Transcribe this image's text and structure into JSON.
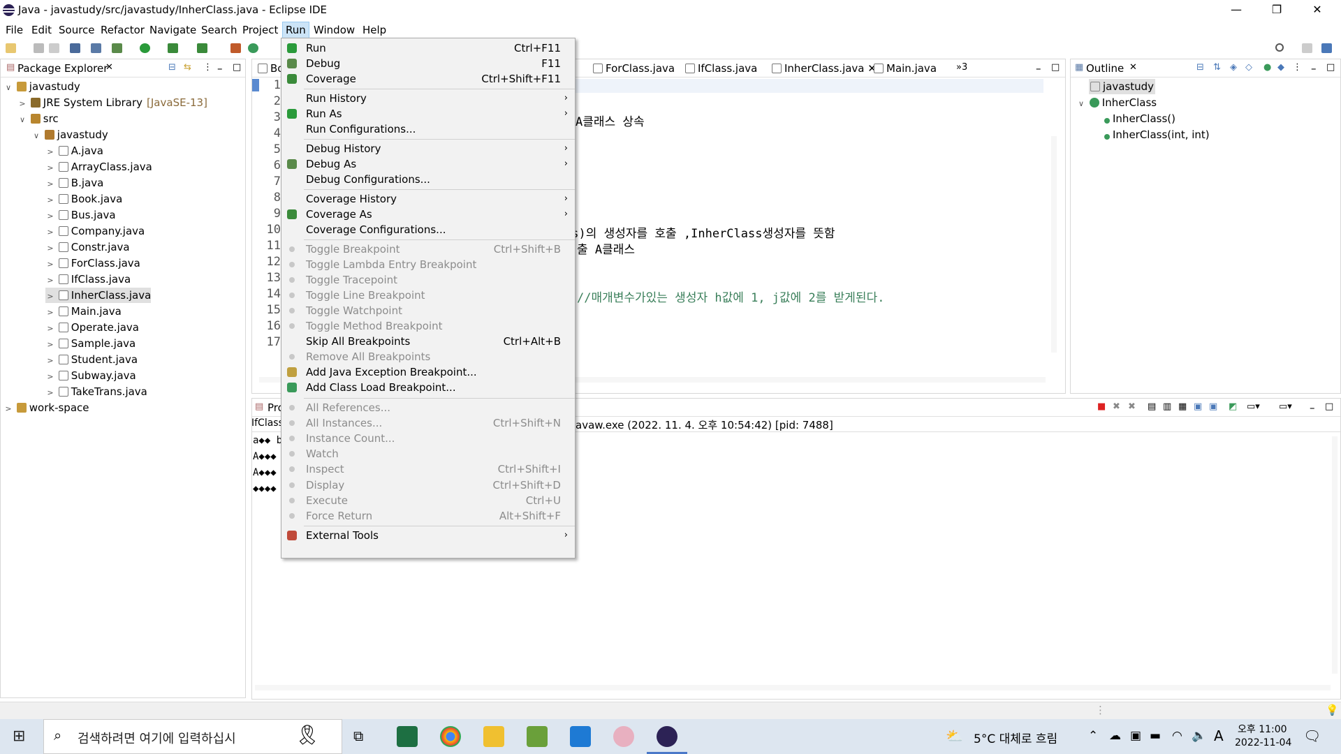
{
  "window": {
    "title": "Java - javastudy/src/javastudy/InherClass.java - Eclipse IDE",
    "min": "—",
    "max": "❐",
    "close": "✕"
  },
  "menubar": [
    "File",
    "Edit",
    "Source",
    "Refactor",
    "Navigate",
    "Search",
    "Project",
    "Run",
    "Window",
    "Help"
  ],
  "package_explorer": {
    "title": "Package Explorer",
    "tree": [
      {
        "label": "javastudy",
        "level": 0,
        "arrow": "∨",
        "icon": "project"
      },
      {
        "label": "JRE System Library",
        "extra": "[JavaSE-13]",
        "level": 1,
        "arrow": ">",
        "icon": "library"
      },
      {
        "label": "src",
        "level": 1,
        "arrow": "∨",
        "icon": "src"
      },
      {
        "label": "javastudy",
        "level": 2,
        "arrow": "∨",
        "icon": "package"
      },
      {
        "label": "A.java",
        "level": 3,
        "arrow": ">",
        "icon": "java"
      },
      {
        "label": "ArrayClass.java",
        "level": 3,
        "arrow": ">",
        "icon": "java"
      },
      {
        "label": "B.java",
        "level": 3,
        "arrow": ">",
        "icon": "java"
      },
      {
        "label": "Book.java",
        "level": 3,
        "arrow": ">",
        "icon": "java"
      },
      {
        "label": "Bus.java",
        "level": 3,
        "arrow": ">",
        "icon": "java"
      },
      {
        "label": "Company.java",
        "level": 3,
        "arrow": ">",
        "icon": "java"
      },
      {
        "label": "Constr.java",
        "level": 3,
        "arrow": ">",
        "icon": "java"
      },
      {
        "label": "ForClass.java",
        "level": 3,
        "arrow": ">",
        "icon": "java"
      },
      {
        "label": "IfClass.java",
        "level": 3,
        "arrow": ">",
        "icon": "java"
      },
      {
        "label": "InherClass.java",
        "level": 3,
        "arrow": ">",
        "icon": "java",
        "selected": true
      },
      {
        "label": "Main.java",
        "level": 3,
        "arrow": ">",
        "icon": "java"
      },
      {
        "label": "Operate.java",
        "level": 3,
        "arrow": ">",
        "icon": "java"
      },
      {
        "label": "Sample.java",
        "level": 3,
        "arrow": ">",
        "icon": "java"
      },
      {
        "label": "Student.java",
        "level": 3,
        "arrow": ">",
        "icon": "java"
      },
      {
        "label": "Subway.java",
        "level": 3,
        "arrow": ">",
        "icon": "java"
      },
      {
        "label": "TakeTrans.java",
        "level": 3,
        "arrow": ">",
        "icon": "java"
      },
      {
        "label": "work-space",
        "level": 0,
        "arrow": ">",
        "icon": "project"
      }
    ]
  },
  "editor": {
    "tabs": [
      "Bo",
      "ForClass.java",
      "IfClass.java",
      "InherClass.java",
      "Main.java"
    ],
    "overflow": "»3",
    "line_numbers": [
      "1",
      "2",
      "3",
      "4",
      "5",
      "6",
      "7",
      "8",
      "9",
      "10",
      "11",
      "12",
      "13",
      "14",
      "15",
      "16",
      "17"
    ],
    "visible_code": {
      "l3": "A클래스 상속",
      "l10": "ss)의 생성자를 호출 ,InherClass생성자를 뜻함",
      "l11": "출 A클래스",
      "l14": "//매개변수가있는 생성자 h값에 1, j값에 2를 받게된다."
    }
  },
  "outline": {
    "title": "Outline",
    "items": [
      {
        "label": "javastudy"
      },
      {
        "label": "InherClass"
      },
      {
        "label": "InherClass()"
      },
      {
        "label": "InherClass(int, int)"
      }
    ]
  },
  "console": {
    "tab": "Pro",
    "header_left": "IfClass",
    "header": "avaw.exe  (2022. 11. 4. 오후 10:54:42) [pid: 7488]",
    "lines": [
      "a◆◆ b",
      "A◆◆◆",
      "A◆◆◆",
      "◆◆◆◆"
    ]
  },
  "run_menu": {
    "items": [
      {
        "label": "Run",
        "accel": "Ctrl+F11",
        "icon": "run"
      },
      {
        "label": "Debug",
        "accel": "F11",
        "icon": "debug"
      },
      {
        "label": "Coverage",
        "accel": "Ctrl+Shift+F11",
        "icon": "coverage"
      },
      {
        "sep": true
      },
      {
        "label": "Run History",
        "submenu": true
      },
      {
        "label": "Run As",
        "submenu": true,
        "icon": "run"
      },
      {
        "label": "Run Configurations..."
      },
      {
        "sep": true
      },
      {
        "label": "Debug History",
        "submenu": true
      },
      {
        "label": "Debug As",
        "submenu": true,
        "icon": "debug"
      },
      {
        "label": "Debug Configurations..."
      },
      {
        "sep": true
      },
      {
        "label": "Coverage History",
        "submenu": true
      },
      {
        "label": "Coverage As",
        "submenu": true,
        "icon": "coverage"
      },
      {
        "label": "Coverage Configurations..."
      },
      {
        "sep": true
      },
      {
        "label": "Toggle Breakpoint",
        "accel": "Ctrl+Shift+B",
        "disabled": true
      },
      {
        "label": "Toggle Lambda Entry Breakpoint",
        "disabled": true
      },
      {
        "label": "Toggle Tracepoint",
        "disabled": true
      },
      {
        "label": "Toggle Line Breakpoint",
        "disabled": true
      },
      {
        "label": "Toggle Watchpoint",
        "disabled": true
      },
      {
        "label": "Toggle Method Breakpoint",
        "disabled": true
      },
      {
        "label": "Skip All Breakpoints",
        "accel": "Ctrl+Alt+B"
      },
      {
        "label": "Remove All Breakpoints",
        "disabled": true
      },
      {
        "label": "Add Java Exception Breakpoint...",
        "icon": "exception"
      },
      {
        "label": "Add Class Load Breakpoint...",
        "icon": "classload"
      },
      {
        "sep": true
      },
      {
        "label": "All References...",
        "disabled": true
      },
      {
        "label": "All Instances...",
        "accel": "Ctrl+Shift+N",
        "disabled": true
      },
      {
        "label": "Instance Count...",
        "disabled": true
      },
      {
        "label": "Watch",
        "disabled": true
      },
      {
        "label": "Inspect",
        "accel": "Ctrl+Shift+I",
        "disabled": true
      },
      {
        "label": "Display",
        "accel": "Ctrl+Shift+D",
        "disabled": true
      },
      {
        "label": "Execute",
        "accel": "Ctrl+U",
        "disabled": true
      },
      {
        "label": "Force Return",
        "accel": "Alt+Shift+F",
        "disabled": true
      },
      {
        "sep": true
      },
      {
        "label": "External Tools",
        "submenu": true,
        "icon": "external"
      }
    ]
  },
  "taskbar": {
    "search_placeholder": "검색하려면 여기에 입력하십시",
    "weather": "5°C 대체로 흐림",
    "ime": "A",
    "time": "오후 11:00",
    "date": "2022-11-04"
  },
  "colors": {
    "menu_active": "#cce4f7",
    "selection": "#e0e0e0",
    "accent_eclipse": "#2c2255"
  }
}
